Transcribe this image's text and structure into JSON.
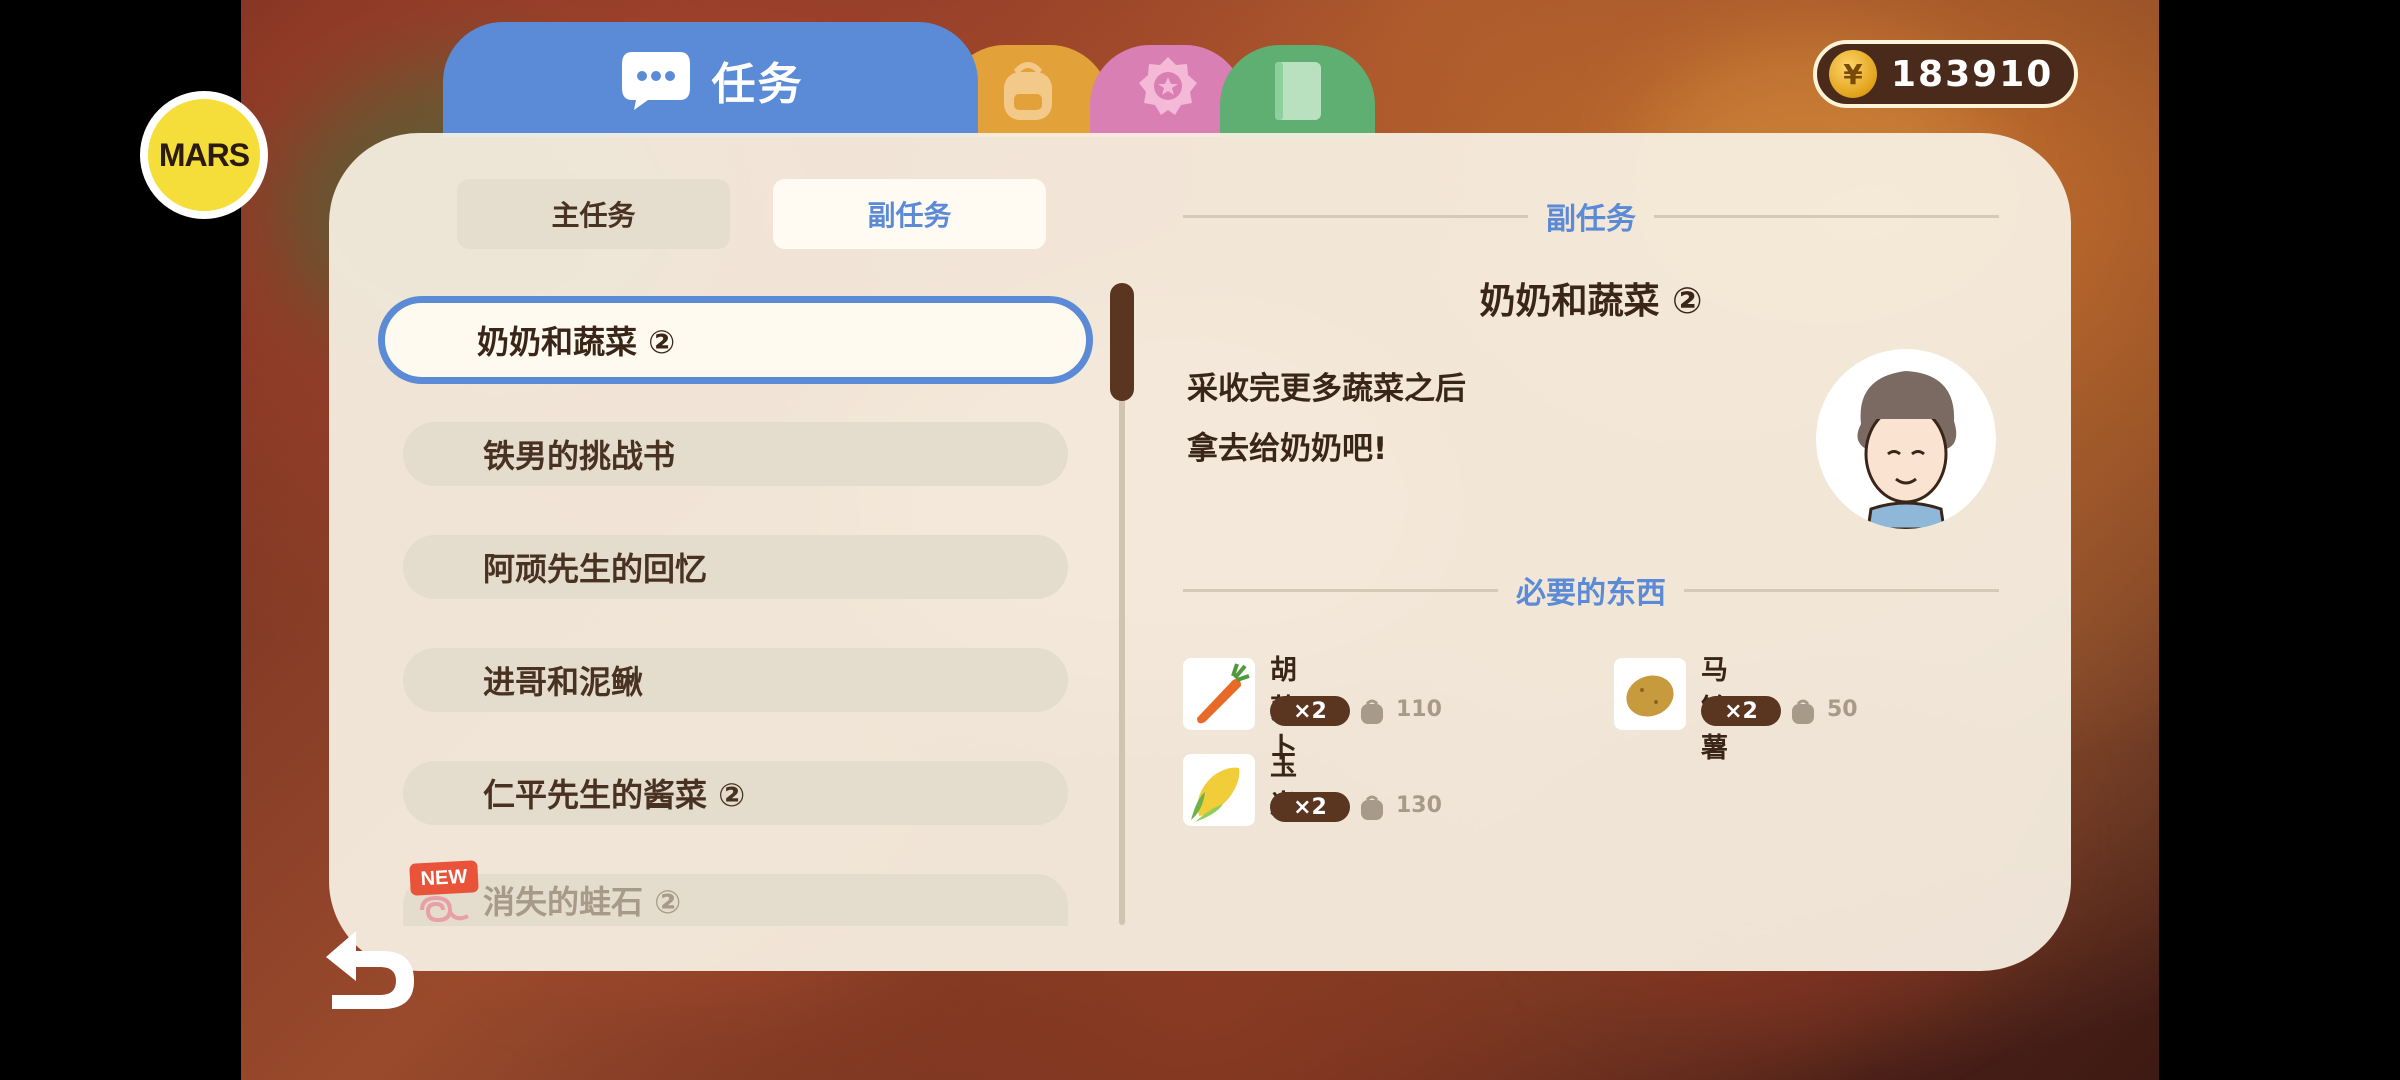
{
  "brand": {
    "logo_text": "MARS"
  },
  "tabs": [
    {
      "name": "quest",
      "label": "任务",
      "color": "#5b8ad6",
      "icon": "chat-bubble-icon"
    },
    {
      "name": "bag",
      "label": "",
      "color": "#e3a13a",
      "icon": "backpack-icon"
    },
    {
      "name": "badge",
      "label": "",
      "color": "#d97fb3",
      "icon": "medal-icon"
    },
    {
      "name": "book",
      "label": "",
      "color": "#5fae72",
      "icon": "book-icon"
    }
  ],
  "currency": {
    "value": "183910",
    "icon": "coin-icon",
    "symbol": "¥"
  },
  "subtabs": {
    "main": "主任务",
    "side": "副任务",
    "active": "side"
  },
  "quest_list": [
    {
      "label": "奶奶和蔬菜 ②",
      "selected": true
    },
    {
      "label": "铁男的挑战书"
    },
    {
      "label": "阿顽先生的回忆"
    },
    {
      "label": "进哥和泥鳅"
    },
    {
      "label": "仁平先生的酱菜 ②"
    },
    {
      "label": "消失的蛙石 ②",
      "new": true
    }
  ],
  "new_badge": "NEW",
  "detail": {
    "section_title": "副任务",
    "title": "奶奶和蔬菜 ②",
    "description": [
      "采收完更多蔬菜之后",
      "拿去给奶奶吧!"
    ],
    "required_title": "必要的东西",
    "required": [
      {
        "name": "胡萝卜",
        "qty": "×2",
        "stock": "110",
        "icon": "carrot-icon"
      },
      {
        "name": "马铃薯",
        "qty": "×2",
        "stock": "50",
        "icon": "potato-icon"
      },
      {
        "name": "玉米",
        "qty": "×2",
        "stock": "130",
        "icon": "corn-icon"
      }
    ]
  },
  "colors": {
    "accent": "#5b8ad6",
    "dark_brown": "#5a3520",
    "panel": "#f7f1e4"
  }
}
